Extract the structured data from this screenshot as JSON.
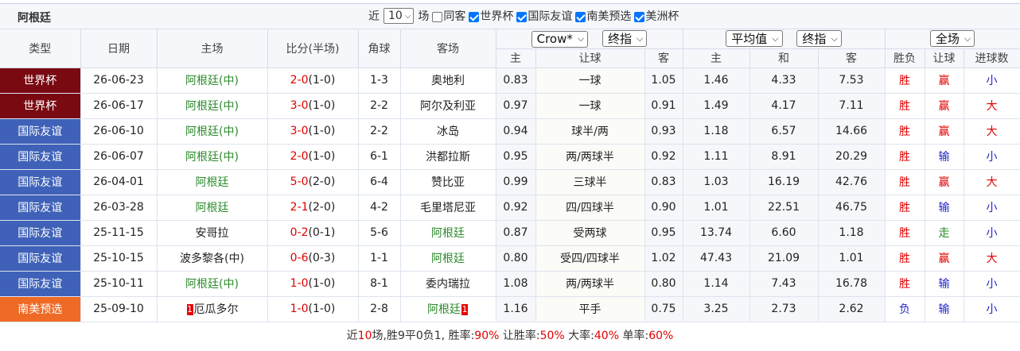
{
  "title": {
    "team": "阿根廷",
    "recent_prefix": "近",
    "recent_count": "10",
    "recent_suffix": "场",
    "checkboxes": [
      {
        "label": "同客",
        "checked": false
      },
      {
        "label": "世界杯",
        "checked": true
      },
      {
        "label": "国际友谊",
        "checked": true
      },
      {
        "label": "南美预选",
        "checked": true
      },
      {
        "label": "美洲杯",
        "checked": true
      }
    ]
  },
  "header": {
    "type": "类型",
    "date": "日期",
    "home": "主场",
    "score": "比分(半场)",
    "corner": "角球",
    "away": "客场",
    "company_select": "Crow*",
    "odds_select1": "终指",
    "avg_select": "平均值",
    "odds_select2": "终指",
    "range_select": "全场",
    "sub": {
      "h_home": "主",
      "handicap": "让球",
      "h_away": "客",
      "e_home": "主",
      "e_draw": "和",
      "e_away": "客",
      "win_loss": "胜负",
      "handicap_result": "让球",
      "goals": "进球数"
    }
  },
  "colors": {
    "world_cup": "#7a0a12",
    "friendly": "#3f62b8",
    "conmebol": "#ee6a25"
  },
  "rows": [
    {
      "league": "世界杯",
      "lc": "world_cup",
      "date": "26-06-23",
      "home": "阿根廷(中)",
      "hc": "green",
      "score": "2-0",
      "half": "(1-0)",
      "corner": "1-3",
      "away": "奥地利",
      "ac": "",
      "o1": "0.83",
      "hcp": "一球",
      "o2": "1.05",
      "e1": "1.46",
      "e2": "4.33",
      "e3": "7.53",
      "wl": "胜",
      "wlc": "red",
      "hr": "赢",
      "hrc": "red",
      "g": "小",
      "gc": "blue",
      "hred": "",
      "ared": ""
    },
    {
      "league": "世界杯",
      "lc": "world_cup",
      "date": "26-06-17",
      "home": "阿根廷(中)",
      "hc": "green",
      "score": "3-0",
      "half": "(1-0)",
      "corner": "2-2",
      "away": "阿尔及利亚",
      "ac": "",
      "o1": "0.97",
      "hcp": "一球",
      "o2": "0.91",
      "e1": "1.49",
      "e2": "4.17",
      "e3": "7.11",
      "wl": "胜",
      "wlc": "red",
      "hr": "赢",
      "hrc": "red",
      "g": "大",
      "gc": "red",
      "hred": "",
      "ared": ""
    },
    {
      "league": "国际友谊",
      "lc": "friendly",
      "date": "26-06-10",
      "home": "阿根廷(中)",
      "hc": "green",
      "score": "3-0",
      "half": "(1-0)",
      "corner": "2-2",
      "away": "冰岛",
      "ac": "",
      "o1": "0.94",
      "hcp": "球半/两",
      "o2": "0.93",
      "e1": "1.18",
      "e2": "6.57",
      "e3": "14.66",
      "wl": "胜",
      "wlc": "red",
      "hr": "赢",
      "hrc": "red",
      "g": "大",
      "gc": "red",
      "hred": "",
      "ared": ""
    },
    {
      "league": "国际友谊",
      "lc": "friendly",
      "date": "26-06-07",
      "home": "阿根廷(中)",
      "hc": "green",
      "score": "2-0",
      "half": "(1-0)",
      "corner": "6-1",
      "away": "洪都拉斯",
      "ac": "",
      "o1": "0.95",
      "hcp": "两/两球半",
      "o2": "0.92",
      "e1": "1.11",
      "e2": "8.91",
      "e3": "20.29",
      "wl": "胜",
      "wlc": "red",
      "hr": "输",
      "hrc": "blue",
      "g": "小",
      "gc": "blue",
      "hred": "",
      "ared": ""
    },
    {
      "league": "国际友谊",
      "lc": "friendly",
      "date": "26-04-01",
      "home": "阿根廷",
      "hc": "green",
      "score": "5-0",
      "half": "(2-0)",
      "corner": "6-4",
      "away": "赞比亚",
      "ac": "",
      "o1": "0.99",
      "hcp": "三球半",
      "o2": "0.83",
      "e1": "1.03",
      "e2": "16.19",
      "e3": "42.76",
      "wl": "胜",
      "wlc": "red",
      "hr": "赢",
      "hrc": "red",
      "g": "大",
      "gc": "red",
      "hred": "",
      "ared": ""
    },
    {
      "league": "国际友谊",
      "lc": "friendly",
      "date": "26-03-28",
      "home": "阿根廷",
      "hc": "green",
      "score": "2-1",
      "half": "(2-0)",
      "corner": "4-2",
      "away": "毛里塔尼亚",
      "ac": "",
      "o1": "0.92",
      "hcp": "四/四球半",
      "o2": "0.90",
      "e1": "1.01",
      "e2": "22.51",
      "e3": "46.75",
      "wl": "胜",
      "wlc": "red",
      "hr": "输",
      "hrc": "blue",
      "g": "小",
      "gc": "blue",
      "hred": "",
      "ared": ""
    },
    {
      "league": "国际友谊",
      "lc": "friendly",
      "date": "25-11-15",
      "home": "安哥拉",
      "hc": "",
      "score": "0-2",
      "half": "(0-1)",
      "corner": "5-6",
      "away": "阿根廷",
      "ac": "green",
      "o1": "0.87",
      "hcp": "受两球",
      "o2": "0.95",
      "e1": "13.74",
      "e2": "6.60",
      "e3": "1.18",
      "wl": "胜",
      "wlc": "red",
      "hr": "走",
      "hrc": "dkgreen",
      "g": "小",
      "gc": "blue",
      "hred": "",
      "ared": ""
    },
    {
      "league": "国际友谊",
      "lc": "friendly",
      "date": "25-10-15",
      "home": "波多黎各(中)",
      "hc": "",
      "score": "0-6",
      "half": "(0-3)",
      "corner": "1-1",
      "away": "阿根廷",
      "ac": "green",
      "o1": "0.80",
      "hcp": "受四/四球半",
      "o2": "1.02",
      "e1": "47.43",
      "e2": "21.09",
      "e3": "1.01",
      "wl": "胜",
      "wlc": "red",
      "hr": "赢",
      "hrc": "red",
      "g": "大",
      "gc": "red",
      "hred": "",
      "ared": ""
    },
    {
      "league": "国际友谊",
      "lc": "friendly",
      "date": "25-10-11",
      "home": "阿根廷(中)",
      "hc": "green",
      "score": "1-0",
      "half": "(1-0)",
      "corner": "8-1",
      "away": "委内瑞拉",
      "ac": "",
      "o1": "1.08",
      "hcp": "两/两球半",
      "o2": "0.80",
      "e1": "1.14",
      "e2": "7.43",
      "e3": "16.78",
      "wl": "胜",
      "wlc": "red",
      "hr": "输",
      "hrc": "blue",
      "g": "小",
      "gc": "blue",
      "hred": "",
      "ared": ""
    },
    {
      "league": "南美预选",
      "lc": "conmebol",
      "date": "25-09-10",
      "home": "厄瓜多尔",
      "hc": "",
      "score": "1-0",
      "half": "(1-0)",
      "corner": "2-8",
      "away": "阿根廷",
      "ac": "green",
      "o1": "1.16",
      "hcp": "平手",
      "o2": "0.75",
      "e1": "3.25",
      "e2": "2.73",
      "e3": "2.62",
      "wl": "负",
      "wlc": "blue",
      "hr": "输",
      "hrc": "blue",
      "g": "小",
      "gc": "blue",
      "hred": "1",
      "ared": "1"
    }
  ],
  "summary": {
    "p1": "近",
    "games": "10",
    "p2": "场,胜9平0负1, 胜率:",
    "win_rate": "90%",
    "p3": " 让胜率:",
    "hcp_rate": "50%",
    "p4": " 大率:",
    "over_rate": "40%",
    "p5": " 单率:",
    "odd_rate": "60%"
  }
}
